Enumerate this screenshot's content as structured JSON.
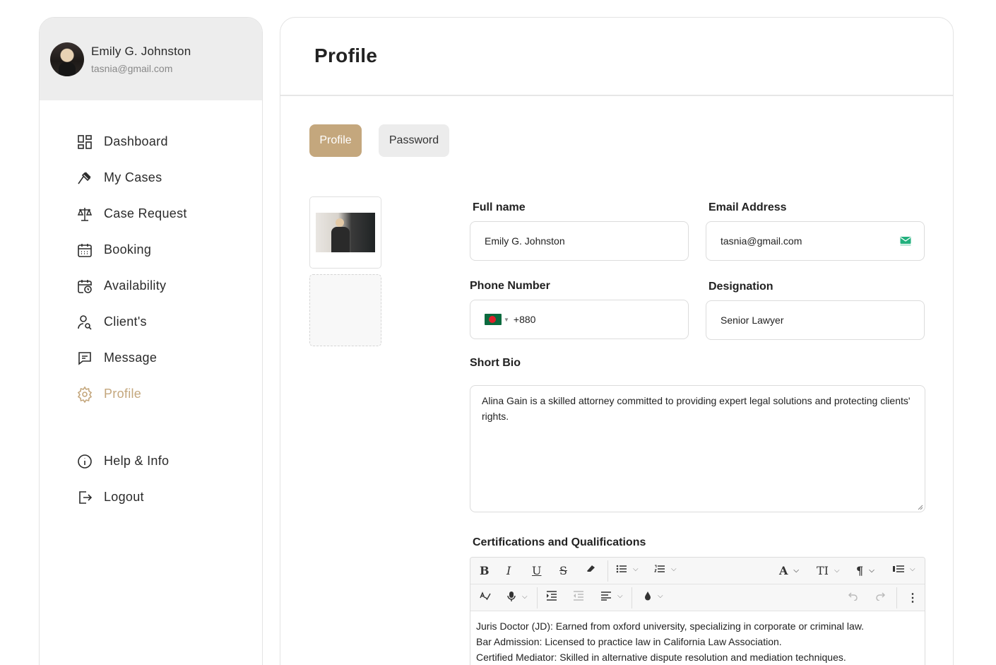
{
  "user": {
    "name": "Emily G. Johnston",
    "email": "tasnia@gmail.com"
  },
  "nav": {
    "items": [
      {
        "label": "Dashboard",
        "icon": "dashboard-grid-icon"
      },
      {
        "label": "My Cases",
        "icon": "gavel-icon"
      },
      {
        "label": "Case Request",
        "icon": "scales-icon"
      },
      {
        "label": "Booking",
        "icon": "calendar-icon"
      },
      {
        "label": "Availability",
        "icon": "calendar-clock-icon"
      },
      {
        "label": "Client's",
        "icon": "user-search-icon"
      },
      {
        "label": "Message",
        "icon": "message-icon"
      },
      {
        "label": "Profile",
        "icon": "gear-icon",
        "active": true
      }
    ],
    "bottom": [
      {
        "label": "Help & Info",
        "icon": "info-icon"
      },
      {
        "label": "Logout",
        "icon": "logout-icon"
      }
    ]
  },
  "page": {
    "title": "Profile"
  },
  "tabs": {
    "profile": "Profile",
    "password": "Password"
  },
  "form": {
    "full_name": {
      "label": "Full name",
      "value": "Emily G. Johnston"
    },
    "email": {
      "label": "Email Address",
      "value": "tasnia@gmail.com"
    },
    "phone": {
      "label": "Phone Number",
      "value": "+880",
      "flag": "bangladesh-flag-icon"
    },
    "designation": {
      "label": "Designation",
      "value": "Senior Lawyer"
    },
    "bio": {
      "label": "Short Bio",
      "value": "Alina Gain is a skilled attorney committed to providing expert legal solutions and protecting clients' rights."
    },
    "certifications": {
      "label": "Certifications and Qualifications",
      "lines": [
        "Juris Doctor (JD): Earned from oxford university, specializing in  corporate or criminal law.",
        "Bar Admission: Licensed to practice law in California Law Association.",
        "Certified Mediator: Skilled in alternative dispute resolution and mediation techniques."
      ]
    }
  },
  "colors": {
    "accent": "#c4a77d",
    "tab_inactive": "#ececec",
    "sidebar_header": "#ededed"
  }
}
